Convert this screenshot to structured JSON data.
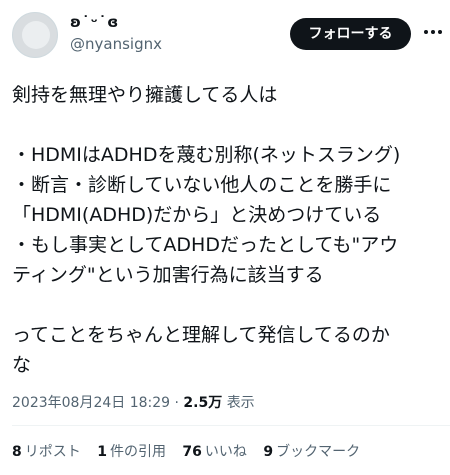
{
  "author": {
    "display_name": "ʚ˙ᵕ˙ɞ",
    "handle": "@nyansignx",
    "avatar_icon": "user-avatar"
  },
  "actions": {
    "follow_label": "フォローする",
    "more_icon": "more-horizontal-icon"
  },
  "tweet": {
    "lines": [
      "剣持を無理やり擁護してる人は",
      "",
      "・HDMIはADHDを蔑む別称(ネットスラング)",
      "・断言・診断していない他人のことを勝手に",
      "「HDMI(ADHD)だから」と決めつけている",
      "・もし事実としてADHDだったとしても\"アウ",
      "ティング\"という加害行為に該当する",
      "",
      "ってことをちゃんと理解して発信してるのか",
      "な"
    ]
  },
  "meta": {
    "timestamp": "2023年08月24日 18:29",
    "separator": "·",
    "views_count": "2.5万",
    "views_label": "表示"
  },
  "stats": {
    "reposts_count": "8",
    "reposts_label": "リポスト",
    "quotes_count": "1",
    "quotes_label": "件の引用",
    "likes_count": "76",
    "likes_label": "いいね",
    "bookmarks_count": "9",
    "bookmarks_label": "ブックマーク"
  },
  "colors": {
    "text_primary": "#0f1419",
    "text_secondary": "#536471",
    "button_bg": "#0f1419",
    "button_text": "#ffffff",
    "divider": "#eff3f4"
  }
}
